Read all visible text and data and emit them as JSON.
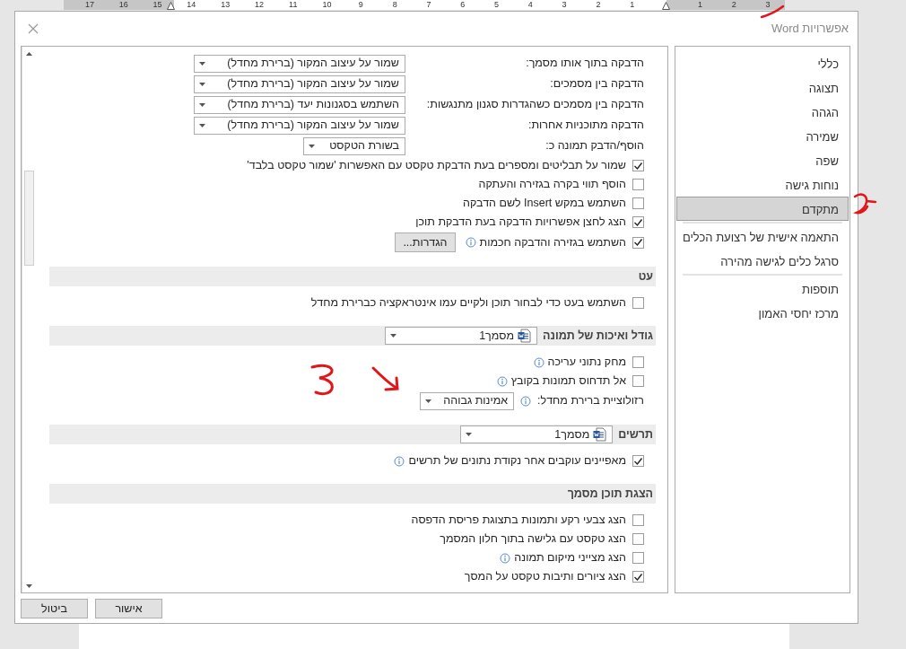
{
  "ruler": {
    "segments": [
      {
        "kind": "margin",
        "labels": [
          "3",
          "2",
          "1"
        ]
      },
      {
        "kind": "text",
        "labels": [
          "1",
          "2",
          "3",
          "4",
          "5",
          "6",
          "7",
          "8",
          "9",
          "10",
          "11",
          "12",
          "13",
          "14"
        ]
      },
      {
        "kind": "margin",
        "labels": [
          "15",
          "16",
          "17"
        ]
      }
    ]
  },
  "window": {
    "title": "אפשרויות Word"
  },
  "sidebar": {
    "groups": [
      {
        "items": [
          {
            "label": "כללי",
            "selected": false
          },
          {
            "label": "תצוגה",
            "selected": false
          },
          {
            "label": "הגהה",
            "selected": false
          },
          {
            "label": "שמירה",
            "selected": false
          },
          {
            "label": "שפה",
            "selected": false
          },
          {
            "label": "נוחות גישה",
            "selected": false
          },
          {
            "label": "מתקדם",
            "selected": true
          }
        ]
      },
      {
        "items": [
          {
            "label": "התאמה אישית של רצועת הכלים",
            "selected": false
          },
          {
            "label": "סרגל כלים לגישה מהירה",
            "selected": false
          }
        ]
      },
      {
        "items": [
          {
            "label": "תוספות",
            "selected": false
          },
          {
            "label": "מרכז יחסי האמון",
            "selected": false
          }
        ]
      }
    ]
  },
  "content": {
    "items": [
      {
        "kind": "select",
        "label": "הדבקה בתוך אותו מסמך:",
        "value": "שמור על עיצוב המקור (ברירת מחדל)"
      },
      {
        "kind": "select",
        "label": "הדבקה בין מסמכים:",
        "value": "שמור על עיצוב המקור (ברירת מחדל)"
      },
      {
        "kind": "select",
        "label": "הדבקה בין מסמכים כשהגדרות סגנון מתנגשות:",
        "value": "השתמש בסגנונות יעד (ברירת מחדל)"
      },
      {
        "kind": "select",
        "label": "הדבקה מתוכניות אחרות:",
        "value": "שמור על עיצוב המקור (ברירת מחדל)"
      },
      {
        "kind": "select",
        "label": "הוסף/הדבק תמונה כ:",
        "value": "בשורת הטקסט",
        "short": true
      },
      {
        "kind": "checkbox",
        "label": "שמור על תבליטים ומספרים בעת הדבקת טקסט עם האפשרות 'שמור טקסט בלבד'",
        "checked": true
      },
      {
        "kind": "checkbox",
        "label": "הוסף תווי בקרה בגזירה והעתקה",
        "checked": false
      },
      {
        "kind": "checkbox",
        "label": "השתמש במקש Insert לשם הדבקה",
        "checked": false
      },
      {
        "kind": "checkbox",
        "label": "הצג לחצן אפשרויות הדבקה בעת הדבקת תוכן",
        "checked": true
      },
      {
        "kind": "checkbox",
        "label": "השתמש בגזירה והדבקה חכמות",
        "checked": true,
        "info": true,
        "button": "הגדרות..."
      },
      {
        "kind": "header",
        "title": "עט"
      },
      {
        "kind": "checkbox",
        "label": "השתמש בעט כדי לבחור תוכן ולקיים עמו אינטראקציה כברירת מחדל",
        "checked": false
      },
      {
        "kind": "header",
        "title": "גודל ואיכות של תמונה",
        "document": "מסמך1"
      },
      {
        "kind": "checkbox",
        "label": "מחק נתוני עריכה",
        "checked": false,
        "info": true
      },
      {
        "kind": "checkbox",
        "label": "אל תדחוס תמונות בקובץ",
        "checked": false,
        "info": true
      },
      {
        "kind": "inline-select",
        "label": "רזולוציית ברירת מחדל:",
        "value": "אמינות גבוהה",
        "info": true
      },
      {
        "kind": "header",
        "title": "תרשים",
        "document": "מסמך1"
      },
      {
        "kind": "checkbox",
        "label": "מאפיינים עוקבים אחר נקודת נתונים של תרשים",
        "checked": true,
        "info": true
      },
      {
        "kind": "header",
        "title": "הצגת תוכן מסמך"
      },
      {
        "kind": "checkbox",
        "label": "הצג צבעי רקע ותמונות בתצוגת פריסת הדפסה",
        "checked": false
      },
      {
        "kind": "checkbox",
        "label": "הצג טקסט עם גלישה בתוך חלון המסמך",
        "checked": false
      },
      {
        "kind": "checkbox",
        "label": "הצג מצייני מיקום תמונה",
        "checked": false,
        "info": true
      },
      {
        "kind": "checkbox",
        "label": "הצג ציורים ותיבות טקסט על המסך",
        "checked": true
      }
    ]
  },
  "buttons": [
    {
      "label": "אישור"
    },
    {
      "label": "ביטול"
    }
  ]
}
